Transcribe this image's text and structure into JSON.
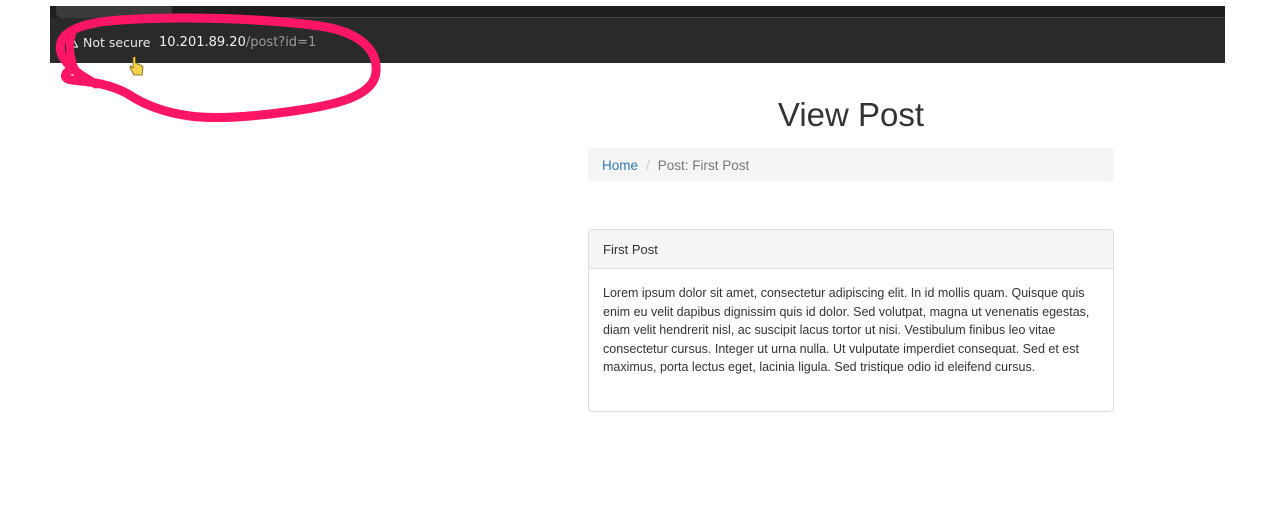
{
  "browser": {
    "security_label": "Not secure",
    "url_host": "10.201.89.20",
    "url_path": "/post?id=1"
  },
  "page": {
    "title": "View Post",
    "breadcrumb": {
      "home": "Home",
      "separator": "/",
      "current": "Post: First Post"
    },
    "post": {
      "heading": "First Post",
      "body": "Lorem ipsum dolor sit amet, consectetur adipiscing elit. In id mollis quam. Quisque quis enim eu velit dapibus dignissim quis id dolor. Sed volutpat, magna ut venenatis egestas, diam velit hendrerit nisl, ac suscipit lacus tortor ut nisi. Vestibulum finibus leo vitae consectetur cursus. Integer ut urna nulla. Ut vulputate imperdiet consequat. Sed et est maximus, porta lectus eget, lacinia ligula. Sed tristique odio id eleifend cursus."
    }
  },
  "colors": {
    "annotation": "#ff1565",
    "link": "#337ab7",
    "chrome_bg": "#2a2a2a"
  },
  "icons": {
    "security": "warning-triangle-icon",
    "cursor": "hand-pointer-icon"
  }
}
